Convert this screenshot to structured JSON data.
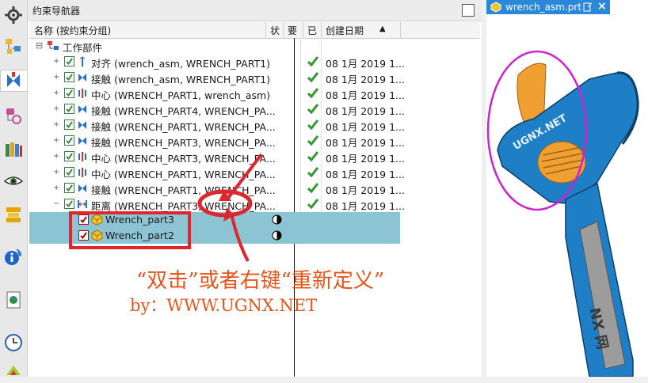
{
  "panel": {
    "title": "约束导航器"
  },
  "columns": {
    "name": "名称 (按约束分组)",
    "status": "状",
    "required": "要",
    "done": "已",
    "created": "创建日期"
  },
  "root": {
    "label": "工作部件"
  },
  "constraints": [
    {
      "label": "对齐 (wrench_asm, WRENCH_PART1)",
      "date": "08 1月 2019 1...",
      "icon": "align-icon"
    },
    {
      "label": "接触 (wrench_asm, WRENCH_PART1)",
      "date": "08 1月 2019 1...",
      "icon": "touch-icon"
    },
    {
      "label": "中心 (WRENCH_PART1, wrench_asm)",
      "date": "08 1月 2019 1...",
      "icon": "center-icon"
    },
    {
      "label": "接触 (WRENCH_PART4, WRENCH_PA...",
      "date": "08 1月 2019 1...",
      "icon": "touch-icon"
    },
    {
      "label": "接触 (WRENCH_PART1, WRENCH_PA...",
      "date": "08 1月 2019 1...",
      "icon": "touch-icon"
    },
    {
      "label": "接触 (WRENCH_PART3, WRENCH_PA...",
      "date": "08 1月 2019 1...",
      "icon": "touch-icon"
    },
    {
      "label": "中心 (WRENCH_PART3, WRENCH_PA...",
      "date": "08 1月 2019 1...",
      "icon": "center-icon"
    },
    {
      "label": "中心 (WRENCH_PART1, WRENCH_PA...",
      "date": "08 1月 2019 1...",
      "icon": "center-icon"
    },
    {
      "label": "接触 (WRENCH_PART1, WRENCH_PA...",
      "date": "08 1月 2019 1...",
      "icon": "touch-icon"
    },
    {
      "label": "距离 (WRENCH_PART3, WRENCH_PA...",
      "date": "08 1月 2019 1...",
      "icon": "distance-icon"
    }
  ],
  "children": [
    {
      "label": "Wrench_part3"
    },
    {
      "label": "Wrench_part2"
    }
  ],
  "annotation": {
    "instruction": "“双击”或者右键“重新定义”",
    "credit": "by：WWW.UGNX.NET"
  },
  "view": {
    "tab_title": "wrench_asm.prt",
    "handle_text": "UGNX.NET",
    "grip_text": "NX 网"
  },
  "colors": {
    "accent": "#2b88d8",
    "selected_row": "#8cc4d4",
    "annotation": "#e8541a",
    "highlight_box": "#e0262d"
  }
}
